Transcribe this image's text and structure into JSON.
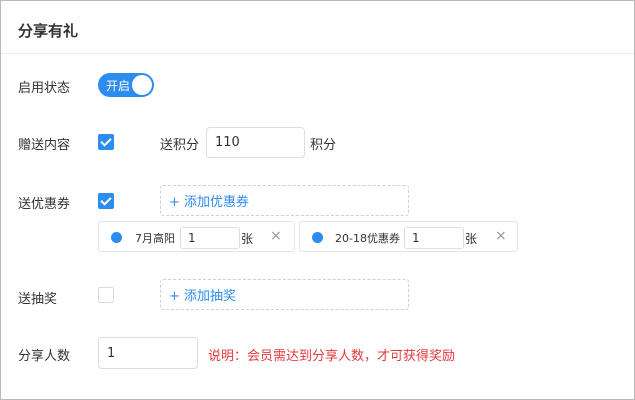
{
  "panel": {
    "title": "分享有礼"
  },
  "status": {
    "label": "启用状态",
    "switch_text": "开启"
  },
  "gift": {
    "label": "赠送内容",
    "points_label": "送积分",
    "points_value": "110",
    "points_unit": "积分"
  },
  "coupon": {
    "label": "送优惠券",
    "add_label": "+ 添加优惠券",
    "items": [
      {
        "name": "7月高阳",
        "qty": "1",
        "unit": "张",
        "remove": "×"
      },
      {
        "name": "20-18优惠券",
        "qty": "1",
        "unit": "张",
        "remove": "×"
      }
    ]
  },
  "lottery": {
    "label": "送抽奖",
    "add_label": "+ 添加抽奖"
  },
  "share": {
    "label": "分享人数",
    "value": "1",
    "note": "说明：会员需达到分享人数，才可获得奖励"
  },
  "colors": {
    "accent": "#2d8cf0",
    "warning": "#e4393c"
  }
}
